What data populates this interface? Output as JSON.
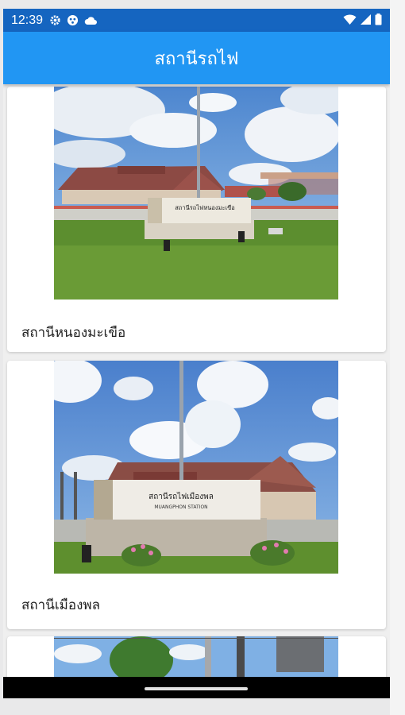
{
  "status_bar": {
    "time": "12:39",
    "icons_left": [
      "settings-icon",
      "app-icon",
      "cloud-icon"
    ],
    "icons_right": [
      "wifi-icon",
      "signal-icon",
      "battery-icon"
    ]
  },
  "app_bar": {
    "title": "สถานีรถไฟ"
  },
  "stations": [
    {
      "name": "สถานีหนองมะเขือ",
      "sign_text": "สถานีรถไฟหนองมะเขือ"
    },
    {
      "name": "สถานีเมืองพล",
      "sign_text": "สถานีรถไฟเมืองพล",
      "sign_subtext": "MUANGPHON STATION"
    }
  ],
  "colors": {
    "status_bar": "#1565c0",
    "app_bar": "#2196f3",
    "nav_bar": "#000000"
  }
}
